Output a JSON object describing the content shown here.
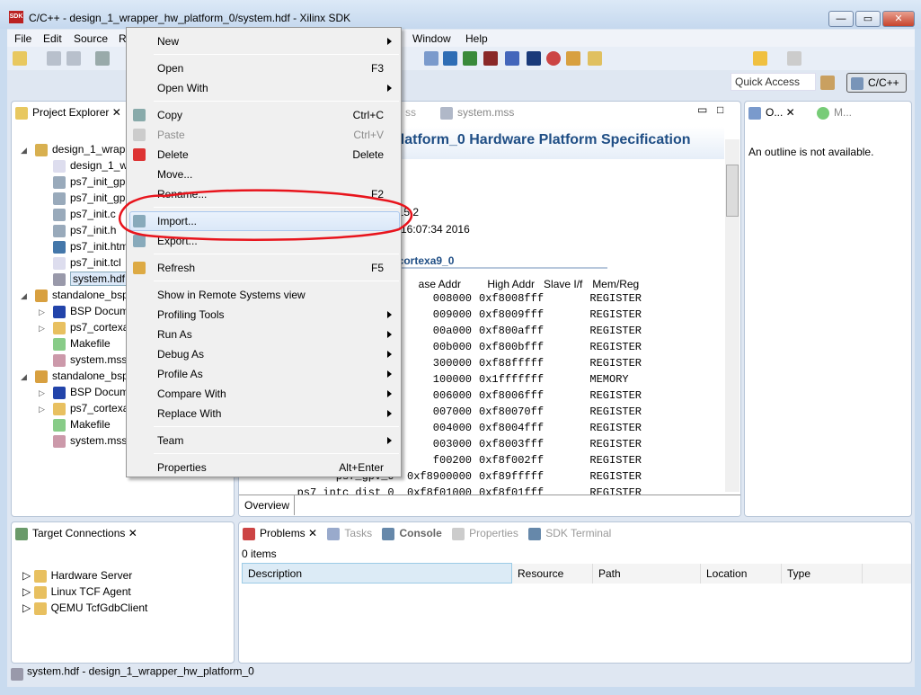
{
  "window": {
    "title": "C/C++ - design_1_wrapper_hw_platform_0/system.hdf - Xilinx SDK",
    "icon_text": "SDK",
    "minimize": "—",
    "maximize": "▭",
    "close": "✕"
  },
  "menubar": [
    "File",
    "Edit",
    "Source",
    "R",
    "Window",
    "Help"
  ],
  "toolbar": {
    "quick_access": "Quick Access",
    "perspective": "C/C++"
  },
  "project_explorer": {
    "title": "Project Explorer",
    "items": [
      {
        "label": "design_1_wrapp",
        "icon": "hw-platform-icon",
        "level": 0,
        "expanded": true
      },
      {
        "label": "design_1_wr",
        "icon": "file-icon",
        "level": 1
      },
      {
        "label": "ps7_init_gpl",
        "icon": "c-file-icon",
        "level": 1
      },
      {
        "label": "ps7_init_gpl",
        "icon": "c-file-icon",
        "level": 1
      },
      {
        "label": "ps7_init.c",
        "icon": "c-file-icon",
        "level": 1
      },
      {
        "label": "ps7_init.h",
        "icon": "h-file-icon",
        "level": 1
      },
      {
        "label": "ps7_init.htm",
        "icon": "html-file-icon",
        "level": 1
      },
      {
        "label": "ps7_init.tcl",
        "icon": "file-icon",
        "level": 1
      },
      {
        "label": "system.hdf",
        "icon": "hdf-file-icon",
        "level": 1,
        "selected": true
      },
      {
        "label": "standalone_bsp",
        "icon": "bsp-icon",
        "level": 0,
        "expanded": true
      },
      {
        "label": "BSP Docum",
        "icon": "info-icon",
        "level": 1,
        "collapsed": true
      },
      {
        "label": "ps7_cortexa9",
        "icon": "folder-icon",
        "level": 1,
        "collapsed": true
      },
      {
        "label": "Makefile",
        "icon": "makefile-icon",
        "level": 1
      },
      {
        "label": "system.mss",
        "icon": "mss-file-icon",
        "level": 1
      },
      {
        "label": "standalone_bsp",
        "icon": "bsp-icon",
        "level": 0,
        "expanded": true
      },
      {
        "label": "BSP Docum",
        "icon": "info-icon",
        "level": 1,
        "collapsed": true
      },
      {
        "label": "ps7_cortexa9",
        "icon": "folder-icon",
        "level": 1,
        "collapsed": true
      },
      {
        "label": "Makefile",
        "icon": "makefile-icon",
        "level": 1
      },
      {
        "label": "system.mss",
        "icon": "mss-file-icon",
        "level": 1
      }
    ]
  },
  "editor": {
    "tabs": [
      "ss",
      "system.mss"
    ],
    "heading": "platform_0 Hardware Platform Specification",
    "info": [
      "015.2",
      "0 16:07:34 2016"
    ],
    "section": "_cortexa9_0",
    "columns": [
      "ase Addr",
      "High Addr",
      "Slave I/f",
      "Mem/Reg"
    ],
    "rows": [
      [
        "008000",
        "0xf8008fff",
        "",
        "REGISTER"
      ],
      [
        "009000",
        "0xf8009fff",
        "",
        "REGISTER"
      ],
      [
        "00a000",
        "0xf800afff",
        "",
        "REGISTER"
      ],
      [
        "00b000",
        "0xf800bfff",
        "",
        "REGISTER"
      ],
      [
        "300000",
        "0xf88fffff",
        "",
        "REGISTER"
      ],
      [
        "100000",
        "0x1fffffff",
        "",
        "MEMORY"
      ],
      [
        "006000",
        "0xf8006fff",
        "",
        "REGISTER"
      ],
      [
        "007000",
        "0xf80070ff",
        "",
        "REGISTER"
      ],
      [
        "004000",
        "0xf8004fff",
        "",
        "REGISTER"
      ],
      [
        "003000",
        "0xf8003fff",
        "",
        "REGISTER"
      ],
      [
        "f00200",
        "0xf8f002ff",
        "",
        "REGISTER"
      ],
      [
        "ps7_gpv_0  0xf8900000",
        "0xf89fffff",
        "",
        "REGISTER"
      ],
      [
        "ps7_intc_dist_0  0xf8f01000",
        "0xf8f01fff",
        "",
        "REGISTER"
      ]
    ],
    "bottom_tab": "Overview"
  },
  "outline": {
    "tab1": "O...",
    "tab2": "M...",
    "message": "An outline is not available."
  },
  "target_connections": {
    "title": "Target Connections",
    "items": [
      "Hardware Server",
      "Linux TCF Agent",
      "QEMU TcfGdbClient"
    ]
  },
  "problems": {
    "tabs": [
      "Problems",
      "Tasks",
      "Console",
      "Properties",
      "SDK Terminal"
    ],
    "count": "0 items",
    "columns": [
      "Description",
      "Resource",
      "Path",
      "Location",
      "Type"
    ]
  },
  "context_menu": {
    "items": [
      {
        "label": "New",
        "submenu": true
      },
      {
        "sep": true
      },
      {
        "label": "Open",
        "shortcut": "F3"
      },
      {
        "label": "Open With",
        "submenu": true
      },
      {
        "sep": true
      },
      {
        "label": "Copy",
        "shortcut": "Ctrl+C",
        "icon": "copy-icon"
      },
      {
        "label": "Paste",
        "shortcut": "Ctrl+V",
        "disabled": true,
        "icon": "paste-icon"
      },
      {
        "label": "Delete",
        "shortcut": "Delete",
        "icon": "delete-icon"
      },
      {
        "label": "Move..."
      },
      {
        "label": "Rename...",
        "shortcut": "F2"
      },
      {
        "sep": true
      },
      {
        "label": "Import...",
        "icon": "import-icon",
        "highlighted": true
      },
      {
        "label": "Export...",
        "icon": "export-icon"
      },
      {
        "sep": true
      },
      {
        "label": "Refresh",
        "shortcut": "F5",
        "icon": "refresh-icon"
      },
      {
        "sep": true
      },
      {
        "label": "Show in Remote Systems view"
      },
      {
        "label": "Profiling Tools",
        "submenu": true
      },
      {
        "label": "Run As",
        "submenu": true
      },
      {
        "label": "Debug As",
        "submenu": true
      },
      {
        "label": "Profile As",
        "submenu": true
      },
      {
        "label": "Compare With",
        "submenu": true
      },
      {
        "label": "Replace With",
        "submenu": true
      },
      {
        "sep": true
      },
      {
        "label": "Team",
        "submenu": true
      },
      {
        "sep": true
      },
      {
        "label": "Properties",
        "shortcut": "Alt+Enter"
      }
    ]
  },
  "annotation_color": "#e8141c",
  "status": "system.hdf - design_1_wrapper_hw_platform_0"
}
